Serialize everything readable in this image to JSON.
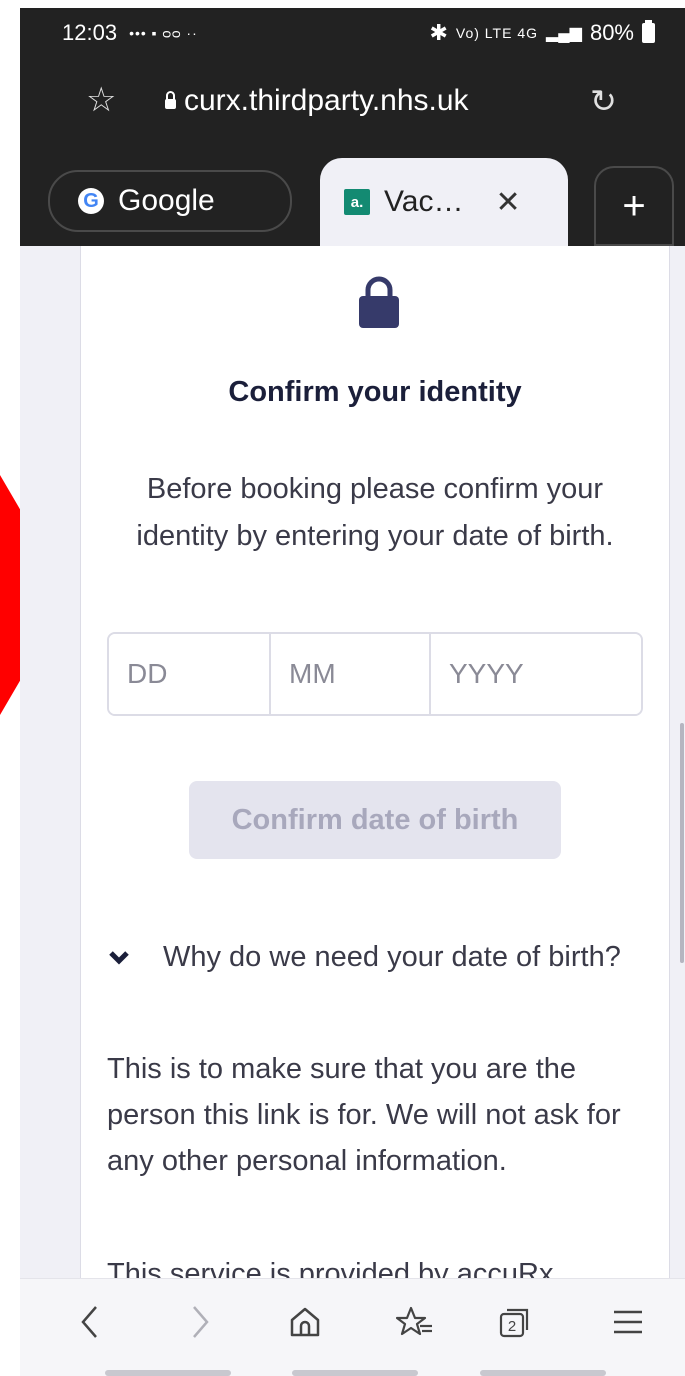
{
  "status_bar": {
    "time": "12:03",
    "left_indicators": "••• ▪ ᴑᴑ ··",
    "network": "Vo) LTE 4G",
    "battery": "80%"
  },
  "browser": {
    "url": "curx.thirdparty.nhs.uk",
    "tabs": [
      {
        "label": "Google"
      },
      {
        "label": "Vac…"
      }
    ],
    "tab_count": "2"
  },
  "page": {
    "title": "Confirm your identity",
    "intro": "Before booking please confirm your identity by entering your date of birth.",
    "dob": {
      "day_placeholder": "DD",
      "month_placeholder": "MM",
      "year_placeholder": "YYYY"
    },
    "confirm_button": "Confirm date of birth",
    "details_summary": "Why do we need your date of birth?",
    "details_body": "This is to make sure that you are the person this link is for. We will not ask for any other personal information.",
    "cutoff_text": "This service is provided by accuRx"
  },
  "colors": {
    "accent_red": "#ff0000",
    "title_navy": "#1b1f3a",
    "lock_navy": "#363a6a",
    "button_disabled_bg": "#e4e4ee"
  },
  "icons": [
    "star-icon",
    "lock-icon",
    "reload-icon",
    "google-icon",
    "favicon",
    "close-icon",
    "plus-icon",
    "padlock-icon",
    "chevron-down-icon",
    "back-icon",
    "forward-icon",
    "home-icon",
    "bookmarks-icon",
    "tabs-icon",
    "menu-icon"
  ]
}
